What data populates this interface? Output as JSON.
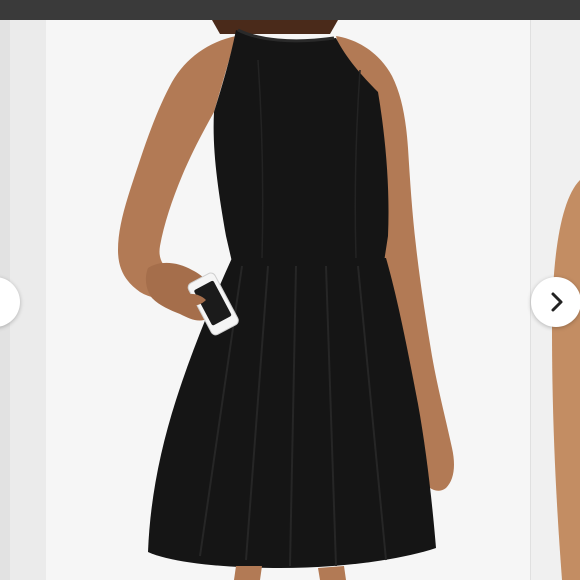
{
  "viewer": {
    "colors": {
      "top_bar": "#3a3a3a",
      "background": "#f6f6f6",
      "dress": "#151515",
      "skin": "#b27a55",
      "nav_button": "#ffffff",
      "chevron": "#222222"
    },
    "icons": {
      "previous": "chevron-left-icon",
      "next": "chevron-right-icon"
    }
  }
}
